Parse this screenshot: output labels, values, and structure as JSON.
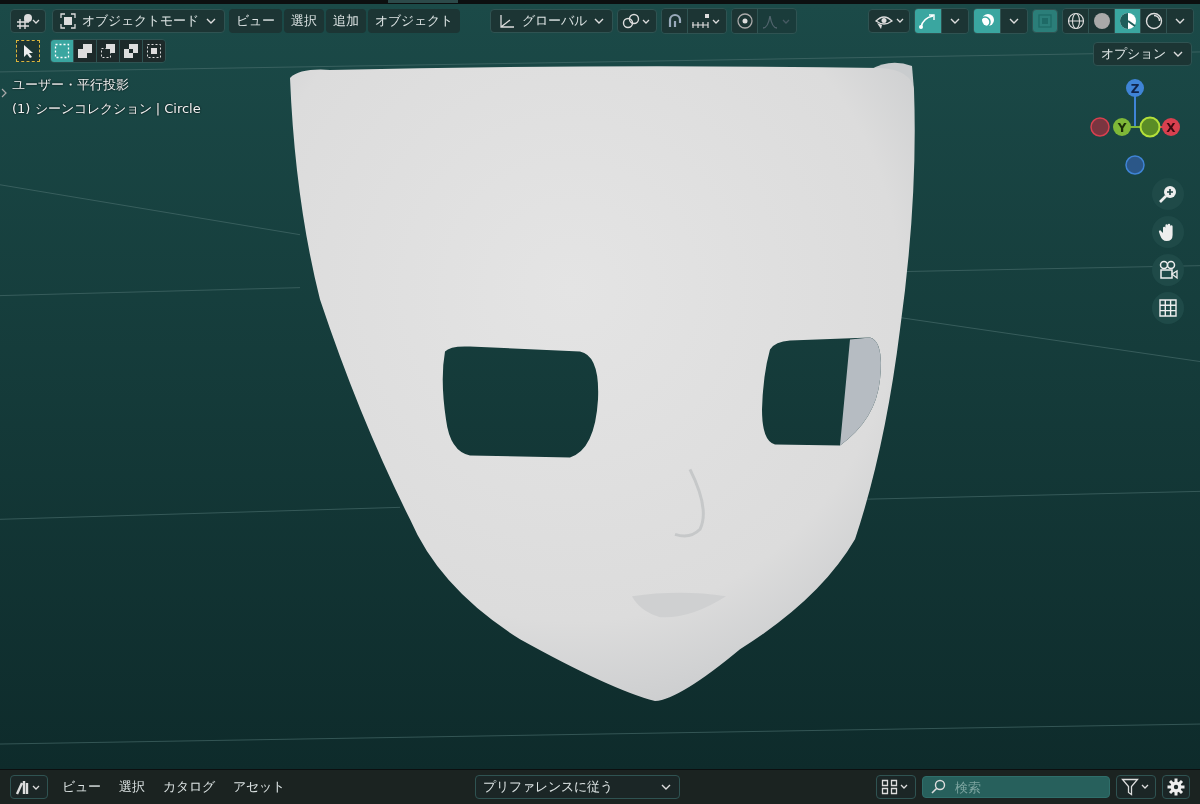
{
  "header": {
    "mode": "オブジェクトモード",
    "menu": [
      "ビュー",
      "選択",
      "追加",
      "オブジェクト"
    ],
    "orientation": "グローバル",
    "options": "オプション"
  },
  "select_modes": [
    {
      "kind": "new",
      "selected": true
    },
    {
      "kind": "extend",
      "selected": false
    },
    {
      "kind": "subtract",
      "selected": false
    },
    {
      "kind": "invert",
      "selected": false
    },
    {
      "kind": "intersect",
      "selected": false
    }
  ],
  "toggles": [
    {
      "kind": "snap",
      "on": false
    },
    {
      "kind": "proportional",
      "on": false
    },
    {
      "kind": "gizmos",
      "on": true
    },
    {
      "kind": "overlays",
      "on": true
    },
    {
      "kind": "xray",
      "on": true
    }
  ],
  "shading": [
    {
      "kind": "wireframe",
      "selected": false
    },
    {
      "kind": "solid",
      "selected": false
    },
    {
      "kind": "material",
      "selected": true
    },
    {
      "kind": "rendered",
      "selected": false
    }
  ],
  "viewport": {
    "view_name": "ユーザー・平行投影",
    "collection_info": "(1) シーンコレクション | Circle"
  },
  "gizmo": {
    "z": "Z",
    "y": "Y",
    "x": "X"
  },
  "asset_bar": {
    "menu": [
      "ビュー",
      "選択",
      "カタログ",
      "アセット"
    ],
    "import_method": "プリファレンスに従う",
    "search": {
      "placeholder": "検索"
    }
  }
}
